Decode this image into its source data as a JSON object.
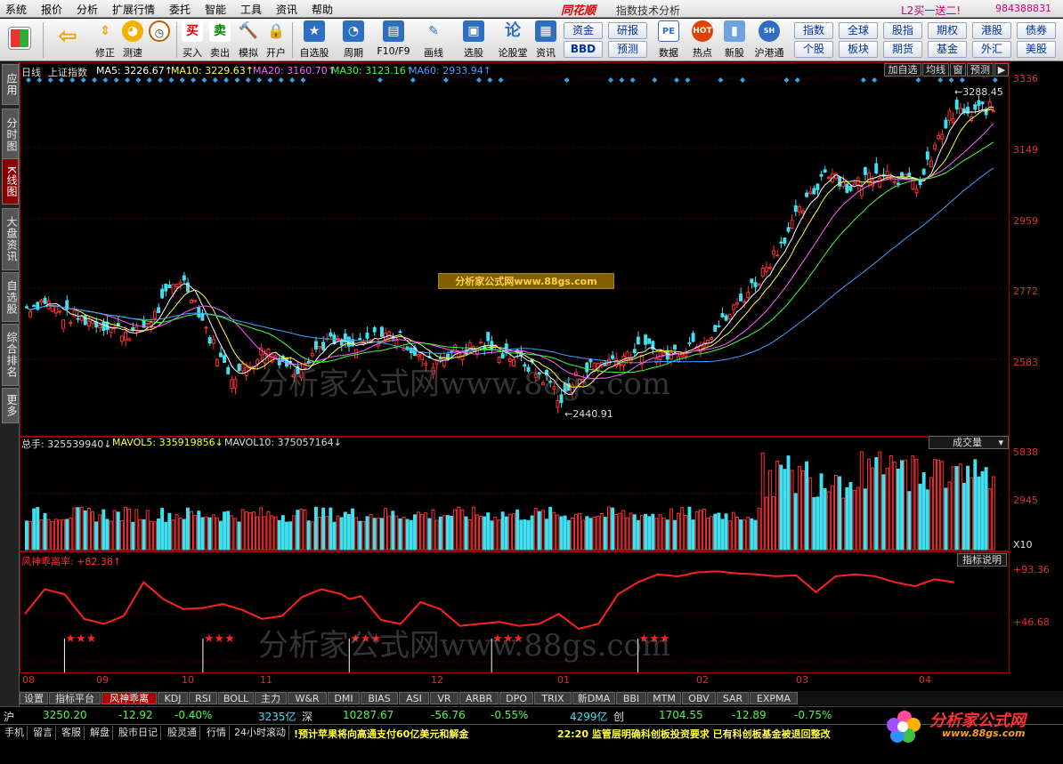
{
  "menu": [
    "系统",
    "报价",
    "分析",
    "扩展行情",
    "委托",
    "智能",
    "工具",
    "资讯",
    "帮助"
  ],
  "brand": "同花顺",
  "window_title": "指数技术分析",
  "promo": "L2买一送二!",
  "account": "984388831",
  "toolbar": [
    {
      "label": "",
      "icon": "grid-icon"
    },
    {
      "label": "",
      "icon": "back-arrow-icon"
    },
    {
      "label": "修正",
      "icon": "up-down-arrow-icon"
    },
    {
      "label": "测速",
      "icon": "clock-icon"
    },
    {
      "label": "买入",
      "icon": "buy-icon",
      "glyph": "买"
    },
    {
      "label": "卖出",
      "icon": "sell-icon",
      "glyph": "卖"
    },
    {
      "label": "模拟",
      "icon": "gavel-icon"
    },
    {
      "label": "开户",
      "icon": "lock-icon"
    },
    {
      "label": "自选股",
      "icon": "star-folder-icon"
    },
    {
      "label": "周期",
      "icon": "period-icon"
    },
    {
      "label": "F10/F9",
      "icon": "f10-icon"
    },
    {
      "label": "画线",
      "icon": "pen-icon"
    },
    {
      "label": "选股",
      "icon": "select-stock-icon"
    },
    {
      "label": "论股堂",
      "icon": "forum-icon"
    },
    {
      "label": "资讯",
      "icon": "news-icon"
    },
    {
      "label": "数据",
      "icon": "pe-icon"
    },
    {
      "label": "热点",
      "icon": "hot-icon"
    },
    {
      "label": "新股",
      "icon": "new-stock-icon"
    },
    {
      "label": "沪港通",
      "icon": "hk-connect-icon"
    }
  ],
  "grid_buttons": [
    [
      "资金",
      "研报"
    ],
    [
      "BBD",
      "预测"
    ],
    [
      "指数",
      "全球",
      "股指",
      "期权",
      "港股",
      "债券"
    ],
    [
      "个股",
      "板块",
      "期货",
      "基金",
      "外汇",
      "美股"
    ]
  ],
  "side_tabs": [
    "应用",
    "分时图",
    "K线图",
    "大盘资讯",
    "自选股",
    "综合排名",
    "更多"
  ],
  "price_header": {
    "period": "日线",
    "name": "上证指数",
    "ma5": "MA5: 3226.67↑",
    "ma10": "MA10: 3229.63↑",
    "ma20": "MA20: 3160.70↑",
    "ma30": "MA30: 3123.16↑",
    "ma60": "MA60: 2933.94↑"
  },
  "right_buttons": [
    "加自选",
    "均线",
    "窗",
    "预测"
  ],
  "price_axis": [
    "3336",
    "3149",
    "2959",
    "2772",
    "2583"
  ],
  "high_label": "3288.45",
  "low_label": "2440.91",
  "banner": "分析家公式网www.88gs.com",
  "watermark": "分析家公式网www.88gs.com",
  "volume_header": {
    "total": "总手: 325539940↓",
    "mavol5": "MAVOL5: 335919856↓",
    "mavol10": "MAVOL10: 375057164↓"
  },
  "volume_selector": "成交量",
  "volume_axis": [
    "5838",
    "2945",
    "X10"
  ],
  "indicator_header": "风神乖离率: +82.38↑",
  "indicator_button": "指标说明",
  "indicator_axis": [
    "+93.36",
    "+46.68"
  ],
  "months": [
    "08",
    "09",
    "10",
    "11",
    "12",
    "01",
    "02",
    "03",
    "04"
  ],
  "bottom_tabs": [
    "设置",
    "指标平台",
    "风神乖离",
    "KDJ",
    "RSI",
    "BOLL",
    "主力",
    "W&R",
    "DMI",
    "BIAS",
    "ASI",
    "VR",
    "ARBR",
    "DPO",
    "TRIX",
    "新DMA",
    "BBI",
    "MTM",
    "OBV",
    "SAR",
    "EXPMA"
  ],
  "quotes": {
    "sh_label": "沪",
    "sh_value": "3250.20",
    "sh_change": "-12.92",
    "sh_pct": "-0.40%",
    "sh_amount": "3235亿",
    "sz_label": "深",
    "sz_value": "10287.67",
    "sz_change": "-56.76",
    "sz_pct": "-0.55%",
    "sz_amount": "4299亿",
    "cy_label": "创",
    "cy_value": "1704.55",
    "cy_change": "-12.89",
    "cy_pct": "-0.75%"
  },
  "status_buttons": [
    "手机",
    "留言",
    "客服",
    "解盘",
    "股市日记",
    "股灵通",
    "行情",
    "24小时滚动"
  ],
  "news1": "!预计苹果将向高通支付60亿美元和解金",
  "news2": "22:20 监管层明确科创板投资要求 已有科创板基金被退回整改",
  "logo_text": "分析家公式网",
  "logo_url": "www.88gs.com",
  "colors": {
    "up": "#ff3030",
    "down": "#40e0f0",
    "ma5": "#ffffff",
    "ma10": "#ffff40",
    "ma20": "#ff60ff",
    "ma30": "#40ff40",
    "ma60": "#40a0ff",
    "indicator": "#ff2020"
  },
  "chart_data": {
    "type": "candlestick",
    "series": [
      {
        "name": "上证指数",
        "close_points": [
          [
            0,
            2720
          ],
          [
            5,
            2740
          ],
          [
            10,
            2700
          ],
          [
            15,
            2690
          ],
          [
            20,
            2680
          ],
          [
            25,
            2660
          ],
          [
            30,
            2650
          ],
          [
            35,
            2700
          ],
          [
            40,
            2780
          ],
          [
            42,
            2800
          ],
          [
            45,
            2760
          ],
          [
            50,
            2640
          ],
          [
            53,
            2580
          ],
          [
            56,
            2540
          ],
          [
            60,
            2560
          ],
          [
            65,
            2610
          ],
          [
            70,
            2580
          ],
          [
            73,
            2550
          ],
          [
            78,
            2600
          ],
          [
            82,
            2630
          ],
          [
            86,
            2620
          ],
          [
            90,
            2610
          ],
          [
            95,
            2640
          ],
          [
            100,
            2650
          ],
          [
            103,
            2630
          ],
          [
            107,
            2590
          ],
          [
            110,
            2570
          ],
          [
            115,
            2600
          ],
          [
            120,
            2610
          ],
          [
            125,
            2620
          ],
          [
            130,
            2600
          ],
          [
            135,
            2580
          ],
          [
            140,
            2540
          ],
          [
            143,
            2520
          ],
          [
            146,
            2470
          ],
          [
            150,
            2530
          ],
          [
            155,
            2570
          ],
          [
            160,
            2580
          ],
          [
            165,
            2600
          ],
          [
            170,
            2610
          ],
          [
            175,
            2590
          ],
          [
            180,
            2620
          ],
          [
            185,
            2640
          ],
          [
            190,
            2680
          ],
          [
            195,
            2740
          ],
          [
            200,
            2800
          ],
          [
            205,
            2880
          ],
          [
            210,
            2960
          ],
          [
            215,
            3030
          ],
          [
            218,
            3090
          ],
          [
            221,
            3080
          ],
          [
            224,
            3040
          ],
          [
            228,
            3060
          ],
          [
            232,
            3090
          ],
          [
            236,
            3080
          ],
          [
            240,
            3060
          ],
          [
            244,
            3050
          ],
          [
            248,
            3150
          ],
          [
            252,
            3230
          ],
          [
            256,
            3250
          ],
          [
            258,
            3230
          ],
          [
            261,
            3260
          ],
          [
            264,
            3250
          ]
        ]
      }
    ],
    "ylim": [
      2400,
      3336
    ],
    "volume_ylim": [
      0,
      5838
    ],
    "indicator_ylim": [
      0,
      93.36
    ],
    "indicator_points": [
      [
        0,
        50
      ],
      [
        5,
        75
      ],
      [
        10,
        70
      ],
      [
        15,
        45
      ],
      [
        20,
        40
      ],
      [
        25,
        48
      ],
      [
        30,
        82
      ],
      [
        35,
        65
      ],
      [
        40,
        55
      ],
      [
        45,
        56
      ],
      [
        50,
        60
      ],
      [
        55,
        54
      ],
      [
        60,
        45
      ],
      [
        65,
        48
      ],
      [
        70,
        67
      ],
      [
        75,
        75
      ],
      [
        80,
        70
      ],
      [
        82,
        65
      ],
      [
        85,
        68
      ],
      [
        90,
        44
      ],
      [
        95,
        40
      ],
      [
        100,
        62
      ],
      [
        105,
        55
      ],
      [
        110,
        38
      ],
      [
        115,
        40
      ],
      [
        120,
        42
      ],
      [
        125,
        38
      ],
      [
        130,
        40
      ],
      [
        135,
        50
      ],
      [
        140,
        35
      ],
      [
        145,
        40
      ],
      [
        150,
        70
      ],
      [
        155,
        82
      ],
      [
        160,
        90
      ],
      [
        165,
        88
      ],
      [
        170,
        92
      ],
      [
        175,
        93
      ],
      [
        180,
        91
      ],
      [
        185,
        90
      ],
      [
        190,
        88
      ],
      [
        195,
        89
      ],
      [
        200,
        72
      ],
      [
        205,
        88
      ],
      [
        210,
        90
      ],
      [
        215,
        88
      ],
      [
        220,
        82
      ],
      [
        225,
        78
      ],
      [
        230,
        85
      ],
      [
        235,
        82
      ]
    ],
    "stars_at": [
      10,
      45,
      82,
      118,
      155
    ]
  }
}
